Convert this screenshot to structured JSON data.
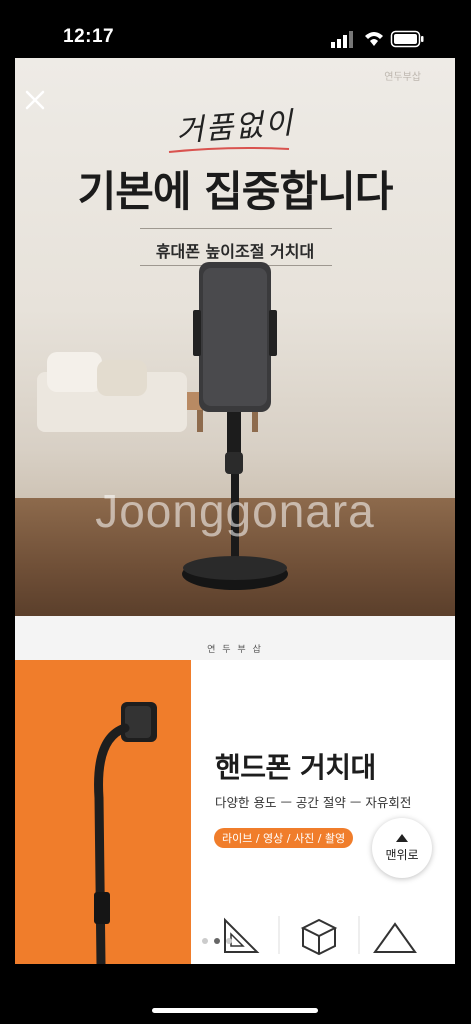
{
  "status_bar": {
    "time": "12:17"
  },
  "banner1": {
    "brand": "연두부삽",
    "script": "거품없이",
    "headline": "기본에 집중합니다",
    "subtitle": "휴대폰 높이조절 거치대",
    "watermark": "Joonggonara"
  },
  "brand_strip": "연 두 부 삽",
  "banner2": {
    "title": "핸드폰 거치대",
    "features": "다양한 용도 ㅡ 공간 절약 ㅡ 자유회전",
    "pill": "라이브 / 영상 / 사진 / 촬영"
  },
  "top_button": {
    "label": "맨위로"
  },
  "colors": {
    "accent": "#f07d2b",
    "script_underline": "#d9534f"
  }
}
